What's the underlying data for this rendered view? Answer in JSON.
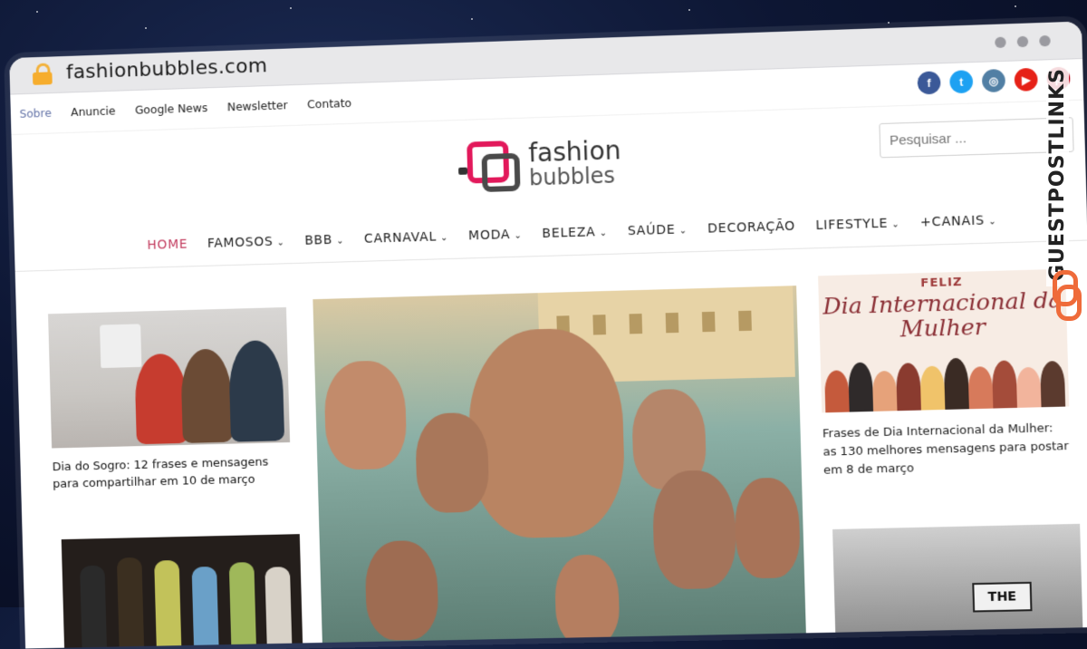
{
  "browser": {
    "url": "fashionbubbles.com"
  },
  "topnav": {
    "items": [
      "Sobre",
      "Anuncie",
      "Google News",
      "Newsletter",
      "Contato"
    ]
  },
  "social": {
    "icons": [
      "facebook-icon",
      "twitter-icon",
      "instagram-icon",
      "youtube-icon",
      "pinterest-icon"
    ],
    "colors": [
      "#3b5998",
      "#1da1f2",
      "#517fa4",
      "#e62117",
      "#bd081c"
    ]
  },
  "logo": {
    "word1": "fashion",
    "word2": "bubbles"
  },
  "search": {
    "placeholder": "Pesquisar ..."
  },
  "mainnav": {
    "items": [
      {
        "label": "HOME",
        "dropdown": false
      },
      {
        "label": "FAMOSOS",
        "dropdown": true
      },
      {
        "label": "BBB",
        "dropdown": true
      },
      {
        "label": "CARNAVAL",
        "dropdown": true
      },
      {
        "label": "MODA",
        "dropdown": true
      },
      {
        "label": "BELEZA",
        "dropdown": true
      },
      {
        "label": "SAÚDE",
        "dropdown": true
      },
      {
        "label": "DECORAÇÃO",
        "dropdown": false
      },
      {
        "label": "LIFESTYLE",
        "dropdown": true
      },
      {
        "label": "+CANAIS",
        "dropdown": true
      }
    ]
  },
  "articles": {
    "sogro": {
      "caption": "Dia do Sogro: 12 frases e mensagens para compartilhar em 10 de março"
    },
    "mulher": {
      "banner_top": "FELIZ",
      "banner_title": "Dia Internacional da Mulher",
      "caption": "Frases de Dia Internacional da Mulher: as 130 melhores mensagens para postar em 8 de março"
    },
    "protest": {
      "sign_text": "THE"
    }
  },
  "watermark": {
    "text": "GUESTPOSTLINKS"
  },
  "colors": {
    "accent": "#c23a5d",
    "logo_pink": "#e2195b",
    "logo_dark": "#4a4a4a"
  }
}
